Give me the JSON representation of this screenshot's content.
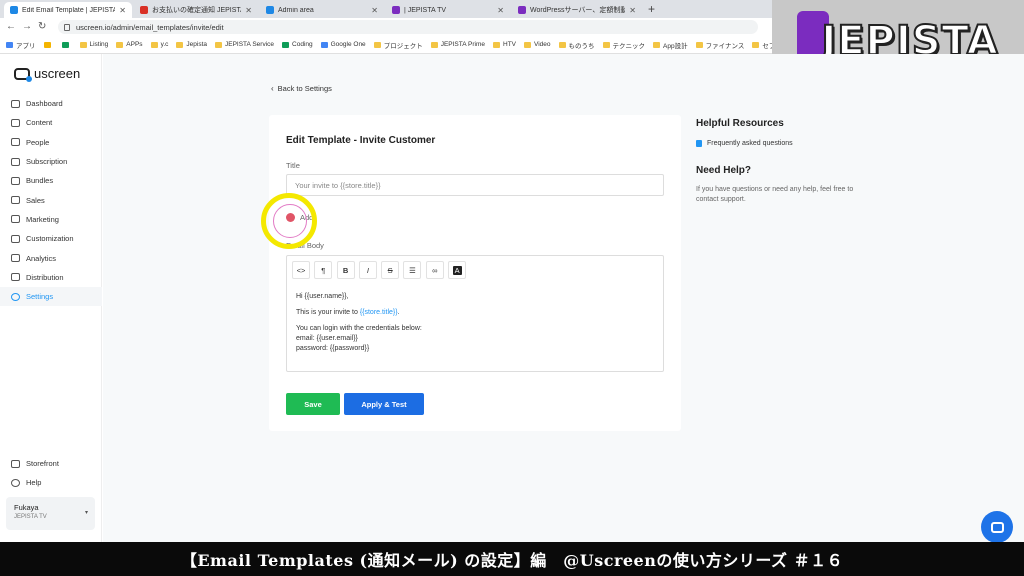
{
  "browser": {
    "tabs": [
      {
        "label": "Edit Email Template | JEPISTA TV",
        "active": true,
        "color": "#1e88e5"
      },
      {
        "label": "お支払いの確定通知 JEPISTA TV -",
        "active": false,
        "color": "#d93025"
      },
      {
        "label": "Admin area",
        "active": false,
        "color": "#1e88e5"
      },
      {
        "label": "| JEPISTA TV",
        "active": false,
        "color": "#7b2cbf"
      },
      {
        "label": "WordPressサーバー、定額制動画配",
        "active": false,
        "color": "#7b2cbf"
      }
    ],
    "new_tab": "+",
    "url": "uscreen.io/admin/email_templates/invite/edit",
    "bookmarks": [
      "アプリ",
      "Listing",
      "APPs",
      "y.c",
      "Jepista",
      "JEPISTA Service",
      "Coding",
      "Google One",
      "プロジェクト",
      "JEPISTA Prime",
      "HTV",
      "Video",
      "ものうち",
      "テクニック",
      "App設計",
      "ファイナンス",
      "セブ"
    ]
  },
  "overlay_logo": "JEPISTA",
  "sidebar": {
    "brand": "uscreen",
    "items": [
      {
        "label": "Dashboard",
        "icon": "dashboard-icon"
      },
      {
        "label": "Content",
        "icon": "folder-icon"
      },
      {
        "label": "People",
        "icon": "people-icon"
      },
      {
        "label": "Subscription",
        "icon": "refresh-icon"
      },
      {
        "label": "Bundles",
        "icon": "box-icon"
      },
      {
        "label": "Sales",
        "icon": "dollar-icon"
      },
      {
        "label": "Marketing",
        "icon": "megaphone-icon"
      },
      {
        "label": "Customization",
        "icon": "edit-icon"
      },
      {
        "label": "Analytics",
        "icon": "chart-icon"
      },
      {
        "label": "Distribution",
        "icon": "distribution-icon"
      },
      {
        "label": "Settings",
        "icon": "gear-icon",
        "active": true
      }
    ],
    "bottom": [
      {
        "label": "Storefront",
        "icon": "storefront-icon"
      },
      {
        "label": "Help",
        "icon": "help-icon"
      }
    ],
    "account": {
      "name": "Fukaya",
      "store": "JEPISTA TV"
    }
  },
  "main": {
    "back_label": "Back to Settings",
    "card": {
      "title": "Edit Template - Invite Customer",
      "title_label": "Title",
      "title_value": "Your invite to {{store.title}}",
      "addon_label": "Add",
      "body_label": "Email Body",
      "toolbar": [
        "<>",
        "¶",
        "B",
        "I",
        "S",
        "list",
        "link",
        "A"
      ],
      "body": {
        "greeting": "Hi {{user.name}},",
        "invite_prefix": "This is your invite to ",
        "invite_var": "{{store.title}}",
        "invite_suffix": ".",
        "login_line": "You can login with the credentials below:",
        "email_line": "email: {{user.email}}",
        "password_line": "password: {{password}}"
      },
      "save_label": "Save",
      "apply_label": "Apply & Test"
    },
    "resources": {
      "title": "Helpful Resources",
      "faq_link": "Frequently asked questions",
      "help_title": "Need Help?",
      "help_text": "If you have questions or need any help, feel free to contact support."
    }
  },
  "caption": "【Email Templates (通知メール) の設定】編　@Uscreenの使い方シリーズ ＃１６",
  "colors": {
    "accent": "#2196f3",
    "save": "#1fbb54",
    "apply": "#1c6de3",
    "logo_purple": "#7b2cbf"
  }
}
